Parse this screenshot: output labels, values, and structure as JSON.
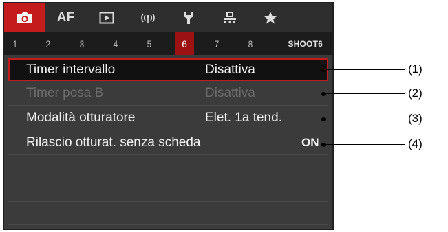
{
  "categories": [
    {
      "id": "shoot",
      "icon": "camera-icon",
      "label": ""
    },
    {
      "id": "af",
      "icon": "",
      "label": "AF"
    },
    {
      "id": "play",
      "icon": "playback-icon",
      "label": ""
    },
    {
      "id": "wireless",
      "icon": "wireless-icon",
      "label": ""
    },
    {
      "id": "setup",
      "icon": "wrench-icon",
      "label": ""
    },
    {
      "id": "custom",
      "icon": "custom-functions-icon",
      "label": ""
    },
    {
      "id": "mymenu",
      "icon": "star-icon",
      "label": ""
    }
  ],
  "active_category": "shoot",
  "page_tabs": [
    "1",
    "2",
    "3",
    "4",
    "5",
    "6",
    "7",
    "8"
  ],
  "active_page": "6",
  "page_label": "SHOOT6",
  "menu": [
    {
      "label": "Timer intervallo",
      "value": "Disattiva",
      "state": "selected"
    },
    {
      "label": "Timer posa B",
      "value": "Disattiva",
      "state": "disabled"
    },
    {
      "label": "Modalità otturatore",
      "value": "Elet. 1a tend.",
      "state": "normal"
    },
    {
      "label": "Rilascio otturat. senza scheda",
      "value": "ON",
      "state": "normal"
    }
  ],
  "callouts": [
    "(1)",
    "(2)",
    "(3)",
    "(4)"
  ],
  "colors": {
    "accent": "#c41c1c",
    "background": "#3b3b3b"
  }
}
